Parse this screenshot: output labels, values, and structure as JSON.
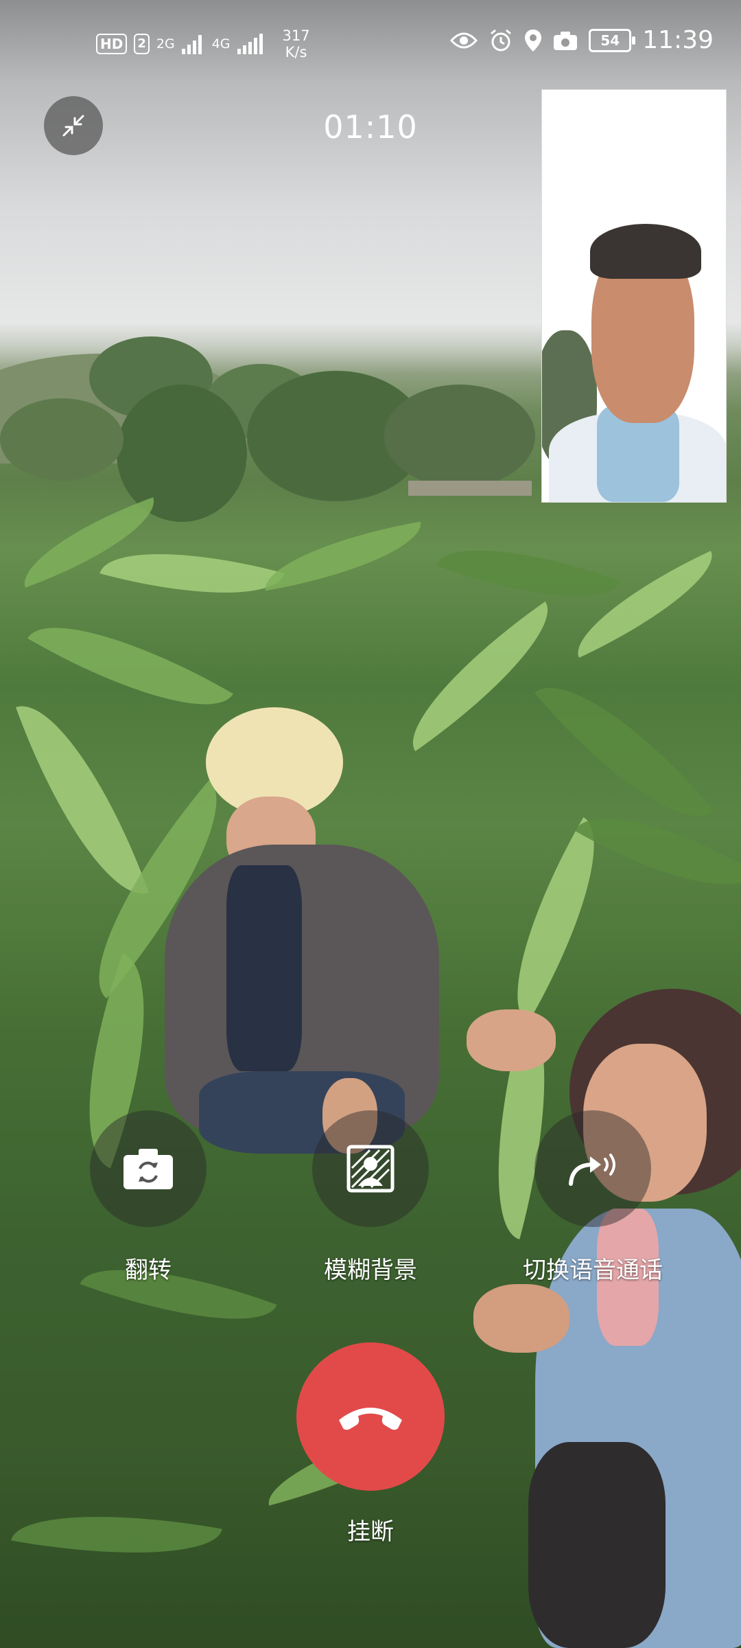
{
  "status_bar": {
    "hd_label": "HD",
    "sim_label": "2",
    "network_1": "2G",
    "network_2": "4G",
    "speed_value": "317",
    "speed_unit": "K/s",
    "battery": "54",
    "time": "11:39",
    "icons": [
      "eye-icon",
      "alarm-icon",
      "location-icon",
      "camera-icon"
    ]
  },
  "call": {
    "duration": "01:10"
  },
  "controls": {
    "flip_label": "翻转",
    "blur_label": "模糊背景",
    "switch_voice_label": "切换语音通话",
    "hangup_label": "挂断"
  },
  "colors": {
    "hangup": "#e24a4a",
    "control_bg": "rgba(40,40,40,0.45)"
  }
}
